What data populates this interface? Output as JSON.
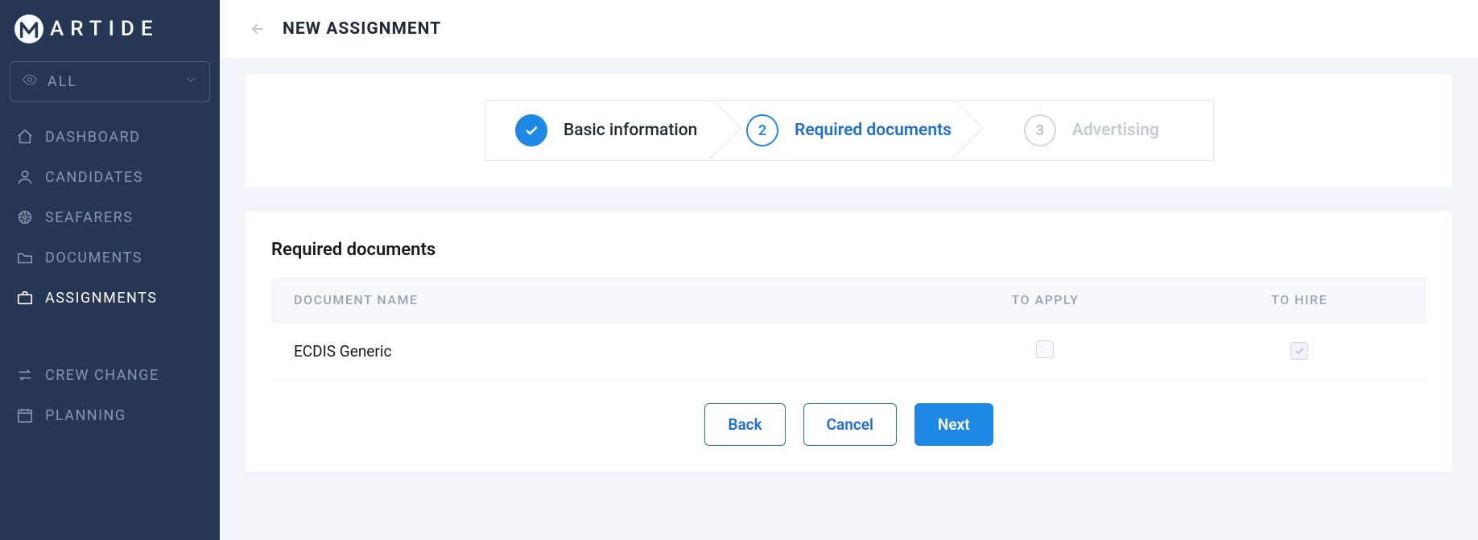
{
  "brand": {
    "name": "ARTIDE"
  },
  "sidebar": {
    "filter_label": "ALL",
    "items": [
      {
        "key": "dashboard",
        "label": "DASHBOARD",
        "active": false
      },
      {
        "key": "candidates",
        "label": "CANDIDATES",
        "active": false
      },
      {
        "key": "seafarers",
        "label": "SEAFARERS",
        "active": false
      },
      {
        "key": "documents",
        "label": "DOCUMENTS",
        "active": false
      },
      {
        "key": "assignments",
        "label": "ASSIGNMENTS",
        "active": true
      }
    ],
    "items2": [
      {
        "key": "crewchange",
        "label": "CREW CHANGE",
        "active": false
      },
      {
        "key": "planning",
        "label": "PLANNING",
        "active": false
      }
    ]
  },
  "header": {
    "title": "NEW ASSIGNMENT"
  },
  "stepper": {
    "steps": [
      {
        "num": "1",
        "label": "Basic information",
        "state": "done"
      },
      {
        "num": "2",
        "label": "Required documents",
        "state": "active"
      },
      {
        "num": "3",
        "label": "Advertising",
        "state": "future"
      }
    ]
  },
  "docs": {
    "section_title": "Required documents",
    "columns": {
      "name": "DOCUMENT NAME",
      "apply": "TO APPLY",
      "hire": "TO HIRE"
    },
    "rows": [
      {
        "name": "ECDIS Generic",
        "apply": false,
        "hire": true
      }
    ]
  },
  "actions": {
    "back": "Back",
    "cancel": "Cancel",
    "next": "Next"
  }
}
